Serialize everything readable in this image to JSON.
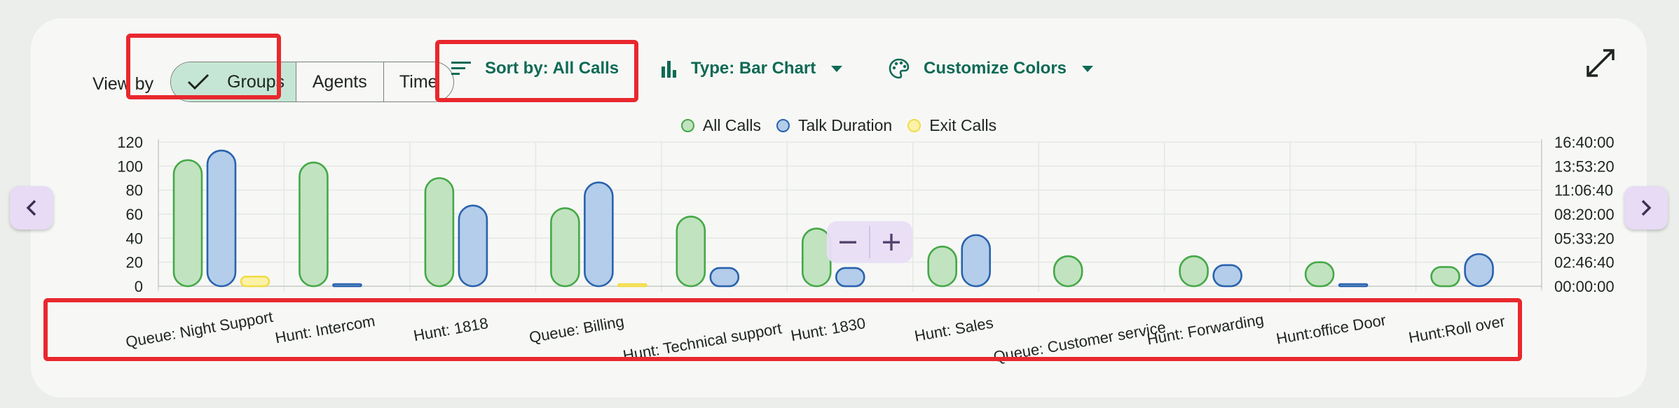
{
  "toolbar": {
    "view_by_label": "View by",
    "view_options": [
      "Groups",
      "Agents",
      "Time"
    ],
    "selected_view": "Groups",
    "sort_label": "Sort by: All Calls",
    "type_label": "Type: Bar Chart",
    "colors_label": "Customize Colors"
  },
  "icons": {
    "check": "check-icon",
    "sort": "sort-icon",
    "bar_chart": "bar-chart-icon",
    "palette": "palette-icon",
    "caret": "caret-down-icon",
    "expand": "expand-icon",
    "prev": "chevron-left-icon",
    "next": "chevron-right-icon",
    "zoom_out": "minus-icon",
    "zoom_in": "plus-icon"
  },
  "colors": {
    "all_calls_fill": "#c1e3c0",
    "all_calls_stroke": "#45a847",
    "talk_fill": "#b3cdea",
    "talk_stroke": "#2a62ad",
    "exit_fill": "#fbf2a8",
    "exit_stroke": "#f1dc48",
    "highlight": "#e8282e",
    "accent": "#0f6a54"
  },
  "chart_data": {
    "type": "bar",
    "categories": [
      "Queue: Night Support",
      "Hunt: Intercom",
      "Hunt: 1818",
      "Queue:  Billing",
      "Hunt: Technical support",
      "Hunt: 1830",
      "Hunt: Sales",
      "Queue:  Customer service",
      "Hunt: Forwarding",
      "Hunt:office Door",
      "Hunt:Roll over"
    ],
    "series": [
      {
        "name": "All Calls",
        "axis": "left",
        "values": [
          105,
          103,
          90,
          65,
          58,
          48,
          33,
          25,
          25,
          20,
          16
        ]
      },
      {
        "name": "Talk Duration",
        "axis": "right",
        "unit_seconds": true,
        "values": [
          56500,
          400,
          33600,
          43200,
          7600,
          7600,
          21300,
          0,
          8800,
          200,
          13400
        ]
      },
      {
        "name": "Exit Calls",
        "axis": "left",
        "values": [
          8,
          0,
          0,
          1,
          0,
          0,
          0,
          0,
          0,
          0,
          0
        ]
      }
    ],
    "y_left": {
      "ylim": [
        0,
        120
      ],
      "ticks": [
        "0",
        "20",
        "40",
        "60",
        "80",
        "100",
        "120"
      ]
    },
    "y_right": {
      "ylim": [
        0,
        60000
      ],
      "ticks": [
        "00:00:00",
        "02:46:40",
        "05:33:20",
        "08:20:00",
        "11:06:40",
        "13:53:20",
        "16:40:00"
      ]
    },
    "grid": true,
    "legend_position": "top-center"
  }
}
